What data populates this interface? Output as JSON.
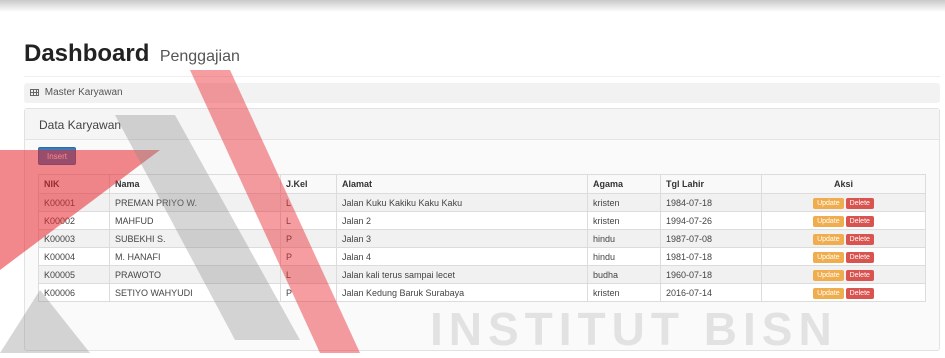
{
  "header": {
    "title": "Dashboard",
    "subtitle": "Penggajian"
  },
  "breadcrumb": {
    "label": "Master Karyawan",
    "icon": "table-icon"
  },
  "panel": {
    "title": "Data Karyawan",
    "insert_label": "Insert"
  },
  "table": {
    "columns": [
      "NIK",
      "Nama",
      "J.Kel",
      "Alamat",
      "Agama",
      "Tgl Lahir",
      "Aksi"
    ],
    "rows": [
      {
        "nik": "K00001",
        "nama": "PREMAN PRIYO W.",
        "jkel": "L",
        "alamat": "Jalan Kuku Kakiku Kaku Kaku",
        "agama": "kristen",
        "tgl": "1984-07-18"
      },
      {
        "nik": "K00002",
        "nama": "MAHFUD",
        "jkel": "L",
        "alamat": "Jalan 2",
        "agama": "kristen",
        "tgl": "1994-07-26"
      },
      {
        "nik": "K00003",
        "nama": "SUBEKHI S.",
        "jkel": "P",
        "alamat": "Jalan 3",
        "agama": "hindu",
        "tgl": "1987-07-08"
      },
      {
        "nik": "K00004",
        "nama": "M. HANAFI",
        "jkel": "P",
        "alamat": "Jalan 4",
        "agama": "hindu",
        "tgl": "1981-07-18"
      },
      {
        "nik": "K00005",
        "nama": "PRAWOTO",
        "jkel": "L",
        "alamat": "Jalan kali terus sampai lecet",
        "agama": "budha",
        "tgl": "1960-07-18"
      },
      {
        "nik": "K00006",
        "nama": "SETIYO WAHYUDI",
        "jkel": "P",
        "alamat": "Jalan Kedung Baruk Surabaya",
        "agama": "kristen",
        "tgl": "2016-07-14"
      }
    ],
    "update_label": "Update",
    "delete_label": "Delete"
  },
  "watermark": {
    "text": "INSTITUT BISN",
    "colors": {
      "red": "#e8262c",
      "gray": "#8a8a8a"
    }
  },
  "colors": {
    "primary": "#3a7dbd",
    "warning": "#f0ad4e",
    "danger": "#d9534f"
  }
}
